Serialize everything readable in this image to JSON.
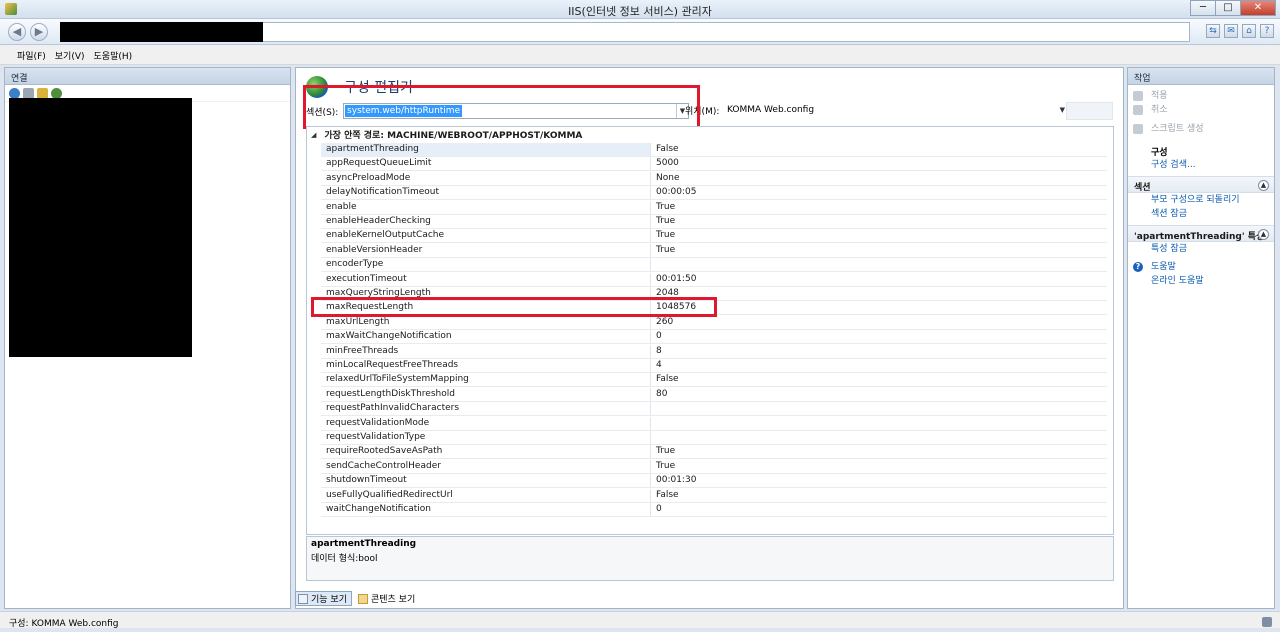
{
  "window": {
    "title": "IIS(인터넷 정보 서비스) 관리자"
  },
  "window_controls": {
    "minimize": "─",
    "maximize": "□",
    "close": "✕"
  },
  "address_bar": {
    "back": "◀",
    "forward": "▶",
    "tools": [
      "⇆",
      "✉",
      "⌂",
      "?"
    ]
  },
  "menu": {
    "items": [
      "파일(F)",
      "보기(V)",
      "도움말(H)"
    ]
  },
  "connections": {
    "header": "연결"
  },
  "editor": {
    "title": "구성 편집기",
    "section_label": "섹션(S):",
    "section_value": "system.web/httpRuntime",
    "location_label": "위치(M):",
    "location_value": "KOMMA Web.config",
    "group_header": "가장 안쪽 경로: MACHINE/WEBROOT/APPHOST/KOMMA",
    "properties": [
      {
        "name": "apartmentThreading",
        "value": "False"
      },
      {
        "name": "appRequestQueueLimit",
        "value": "5000"
      },
      {
        "name": "asyncPreloadMode",
        "value": "None"
      },
      {
        "name": "delayNotificationTimeout",
        "value": "00:00:05"
      },
      {
        "name": "enable",
        "value": "True"
      },
      {
        "name": "enableHeaderChecking",
        "value": "True"
      },
      {
        "name": "enableKernelOutputCache",
        "value": "True"
      },
      {
        "name": "enableVersionHeader",
        "value": "True"
      },
      {
        "name": "encoderType",
        "value": ""
      },
      {
        "name": "executionTimeout",
        "value": "00:01:50"
      },
      {
        "name": "maxQueryStringLength",
        "value": "2048"
      },
      {
        "name": "maxRequestLength",
        "value": "1048576"
      },
      {
        "name": "maxUrlLength",
        "value": "260"
      },
      {
        "name": "maxWaitChangeNotification",
        "value": "0"
      },
      {
        "name": "minFreeThreads",
        "value": "8"
      },
      {
        "name": "minLocalRequestFreeThreads",
        "value": "4"
      },
      {
        "name": "relaxedUrlToFileSystemMapping",
        "value": "False"
      },
      {
        "name": "requestLengthDiskThreshold",
        "value": "80"
      },
      {
        "name": "requestPathInvalidCharacters",
        "value": ""
      },
      {
        "name": "requestValidationMode",
        "value": ""
      },
      {
        "name": "requestValidationType",
        "value": ""
      },
      {
        "name": "requireRootedSaveAsPath",
        "value": "True"
      },
      {
        "name": "sendCacheControlHeader",
        "value": "True"
      },
      {
        "name": "shutdownTimeout",
        "value": "00:01:30"
      },
      {
        "name": "useFullyQualifiedRedirectUrl",
        "value": "False"
      },
      {
        "name": "waitChangeNotification",
        "value": "0"
      }
    ],
    "description_title": "apartmentThreading",
    "description_text": "데이터 형식:bool"
  },
  "view_tabs": {
    "features": "기능 보기",
    "content": "콘텐츠 보기"
  },
  "actions": {
    "header": "작업",
    "apply": "적용",
    "cancel": "취소",
    "generate_script": "스크립트 생성",
    "config_title": "구성",
    "config_search": "구성 검색...",
    "section_group": "섹션",
    "revert_to_parent": "부모 구성으로 되돌리기",
    "lock_section": "섹션 잠금",
    "property_group": "'apartmentThreading' 특성",
    "lock_property": "특성 잠금",
    "help": "도움말",
    "online_help": "온라인 도움말"
  },
  "status": {
    "text": "구성: KOMMA Web.config"
  },
  "colors": {
    "highlight_red": "#e0182d",
    "link_blue": "#0b5bb0",
    "selection_blue": "#3399ff"
  }
}
